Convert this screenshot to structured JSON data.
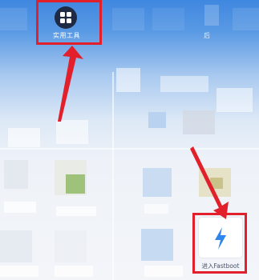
{
  "toolbar": {
    "tools_label": "实用工具",
    "right_label": "后"
  },
  "actions": {
    "fastboot_label": "进入Fastboot"
  },
  "colors": {
    "highlight": "#e2202c",
    "accent_blue": "#3f87e0",
    "icon_dark": "#1f2a44",
    "bolt_blue": "#2f86ea"
  },
  "icons": {
    "tools": "grid-icon",
    "fastboot": "lightning-icon"
  }
}
